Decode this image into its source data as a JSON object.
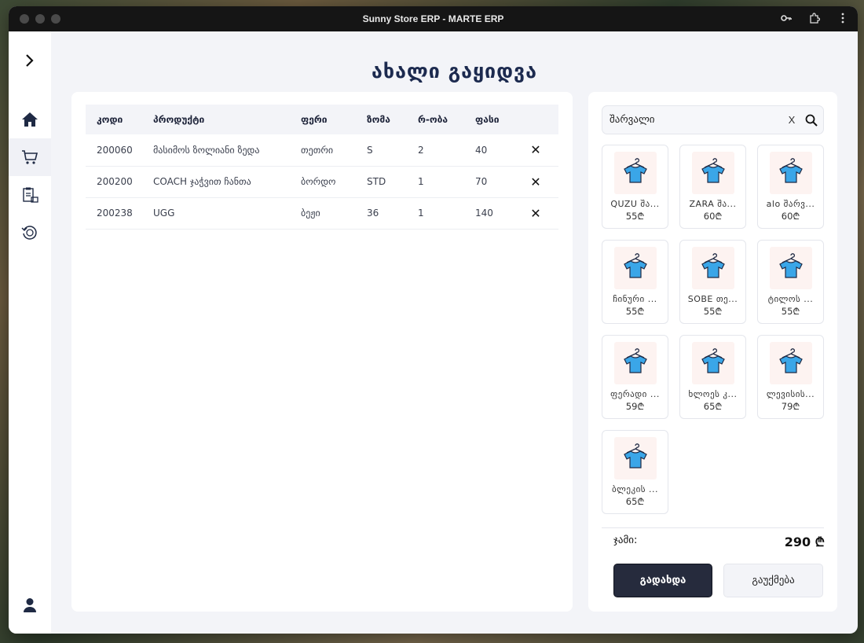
{
  "window": {
    "title": "Sunny Store ERP - MARTE ERP",
    "actions": [
      "key-icon",
      "extension-icon",
      "more-vertical-icon"
    ]
  },
  "sidebar": {
    "toggle_icon": "chevron-right-icon",
    "items": [
      {
        "name": "home",
        "icon": "home-icon",
        "active": false
      },
      {
        "name": "sales",
        "icon": "cart-icon",
        "active": true
      },
      {
        "name": "inventory",
        "icon": "clipboard-icon",
        "active": false
      },
      {
        "name": "returns",
        "icon": "refund-icon",
        "active": false
      }
    ],
    "user_icon": "user-icon"
  },
  "page": {
    "title": "ახალი გაყიდვა"
  },
  "table": {
    "headers": [
      "კოდი",
      "პროდუქტი",
      "ფერი",
      "ზომა",
      "რ-ობა",
      "ფასი"
    ],
    "rows": [
      {
        "code": "200060",
        "product": "მასიმოს ზოლიანი ზედა",
        "color": "თეთრი",
        "size": "S",
        "qty": "2",
        "price": "40"
      },
      {
        "code": "200200",
        "product": "COACH ჯაჭვით ჩანთა",
        "color": "ბორდო",
        "size": "STD",
        "qty": "1",
        "price": "70"
      },
      {
        "code": "200238",
        "product": "UGG",
        "color": "ბეჟი",
        "size": "36",
        "qty": "1",
        "price": "140"
      }
    ],
    "delete_symbol": "✕"
  },
  "search": {
    "value": "შარვალი",
    "clear_label": "X"
  },
  "products": [
    {
      "name": "QUZU შა...",
      "price": "55₾"
    },
    {
      "name": "ZARA შა...",
      "price": "60₾"
    },
    {
      "name": "alo შარვ...",
      "price": "60₾"
    },
    {
      "name": "ჩინური ...",
      "price": "55₾"
    },
    {
      "name": "SOBE თე...",
      "price": "55₾"
    },
    {
      "name": "ტილოს ...",
      "price": "55₾"
    },
    {
      "name": "ფერადი ...",
      "price": "59₾"
    },
    {
      "name": "ხლოეს კ...",
      "price": "65₾"
    },
    {
      "name": "ლევისის...",
      "price": "79₾"
    },
    {
      "name": "ბლეკის ...",
      "price": "65₾"
    }
  ],
  "totals": {
    "label": "ჯამი:",
    "value": "290 ₾"
  },
  "actions": {
    "pay_label": "გადახდა",
    "cancel_label": "გაუქმება"
  },
  "colors": {
    "accent": "#1c2a4f",
    "primary_button": "#262b3d",
    "product_icon": "#3aa6e8"
  }
}
